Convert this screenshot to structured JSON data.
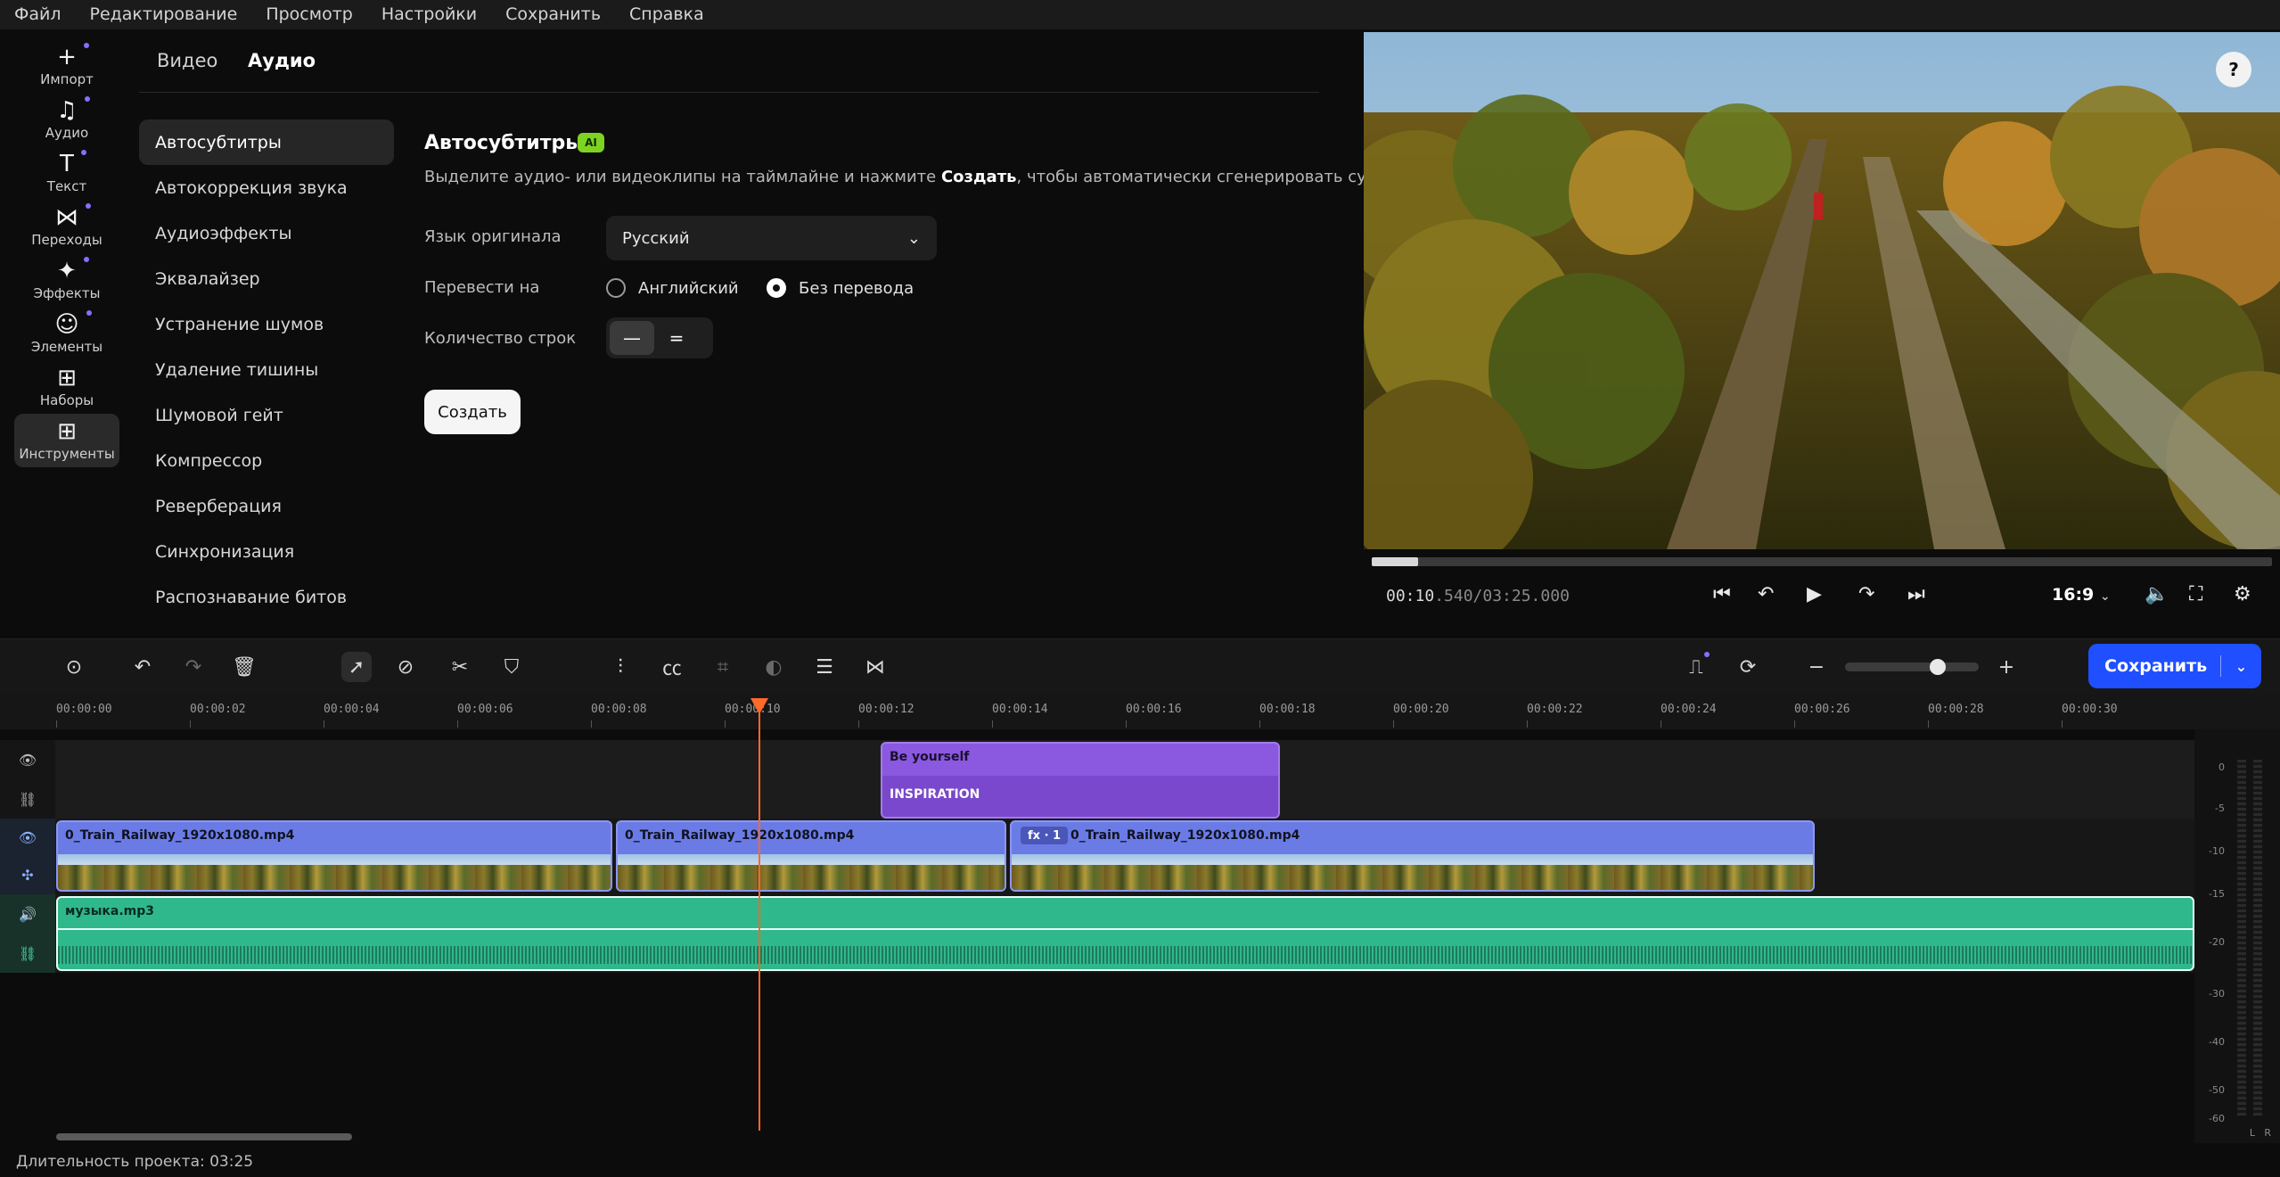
{
  "menu": [
    "Файл",
    "Редактирование",
    "Просмотр",
    "Настройки",
    "Сохранить",
    "Справка"
  ],
  "sidebar": [
    {
      "icon": "plus-icon",
      "label": "Импорт"
    },
    {
      "icon": "music-note-icon",
      "label": "Аудио"
    },
    {
      "icon": "text-t-icon",
      "label": "Текст"
    },
    {
      "icon": "transition-icon",
      "label": "Переходы"
    },
    {
      "icon": "sparkle-icon",
      "label": "Эффекты"
    },
    {
      "icon": "smiley-icon",
      "label": "Элементы"
    },
    {
      "icon": "bag-icon",
      "label": "Наборы"
    },
    {
      "icon": "grid-plus-icon",
      "label": "Инструменты",
      "active": true
    }
  ],
  "tabs": [
    "Видео",
    "Аудио"
  ],
  "active_tab": "Аудио",
  "features": [
    "Автосубтитры",
    "Автокоррекция звука",
    "Аудиоэффекты",
    "Эквалайзер",
    "Устранение шумов",
    "Удаление тишины",
    "Шумовой гейт",
    "Компрессор",
    "Реверберация",
    "Синхронизация",
    "Распознавание битов"
  ],
  "content": {
    "title": "Автосубтитры",
    "badge": "AI",
    "desc_before": "Выделите аудио- или видеоклипы на таймлайне и нажмите ",
    "desc_bold": "Создать",
    "desc_after": ", чтобы автоматически сгенерировать субтитры",
    "lang_label": "Язык оригинала",
    "lang_value": "Русский",
    "translate_label": "Перевести на",
    "translate_options": [
      "Английский",
      "Без перевода"
    ],
    "translate_selected": "Без перевода",
    "lines_label": "Количество строк",
    "create_label": "Создать"
  },
  "preview": {
    "help": "?",
    "time_current_a": "00:10",
    "time_current_b": ".540/03:25.000",
    "progress": 0.051,
    "ratio": "16:9"
  },
  "toolbar": {
    "save_label": "Сохранить",
    "zoom": 0.72
  },
  "ruler": [
    "00:00:00",
    "00:00:02",
    "00:00:04",
    "00:00:06",
    "00:00:08",
    "00:00:10",
    "00:00:12",
    "00:00:14",
    "00:00:16",
    "00:00:18",
    "00:00:20",
    "00:00:22",
    "00:00:24",
    "00:00:26",
    "00:00:28",
    "00:00:30"
  ],
  "clips": {
    "text_top": "Be yourself",
    "text_bottom": "INSPIRATION",
    "video": [
      "0_Train_Railway_1920x1080.mp4",
      "0_Train_Railway_1920x1080.mp4",
      "0_Train_Railway_1920x1080.mp4"
    ],
    "fx": "fx · 1",
    "audio": "музыка.mp3"
  },
  "meter_labels": [
    "0",
    "-5",
    "-10",
    "-15",
    "-20",
    "-30",
    "-40",
    "-50",
    "-60"
  ],
  "meter_channels": [
    "L",
    "R"
  ],
  "status": "Длительность проекта: 03:25",
  "colors": {
    "accent": "#1f4fff",
    "playhead": "#ff6a2a",
    "audio": "#2fb88c",
    "video": "#6b7be6",
    "text": "#8b58e0"
  }
}
